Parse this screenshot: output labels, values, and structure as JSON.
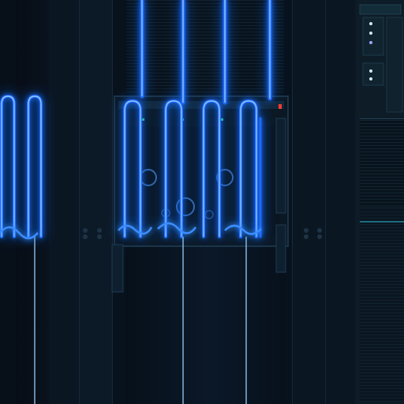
{
  "scene": {
    "subject": "server-rack-with-glowing-blue-cables",
    "colors": {
      "background": "#05090f",
      "rack_panel": "#0c1a26",
      "glow": "#1e6bff",
      "glow_core": "#7fc4ff",
      "led_green": "#2ee06a",
      "led_red": "#ff3b30"
    }
  }
}
